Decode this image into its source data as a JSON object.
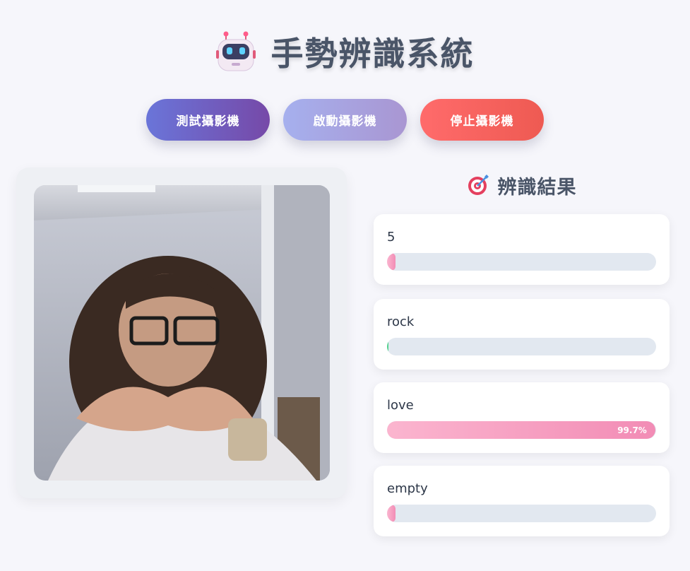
{
  "header": {
    "title": "手勢辨識系統",
    "icon": "robot-icon"
  },
  "buttons": {
    "test_camera": "測試攝影機",
    "start_camera": "啟動攝影機",
    "stop_camera": "停止攝影機"
  },
  "camera": {
    "description": "webcam-feed"
  },
  "results": {
    "title": "辨識結果",
    "icon": "target-icon",
    "items": [
      {
        "label": "5",
        "progress": 0.0,
        "percent_text": ""
      },
      {
        "label": "rock",
        "progress": 0.003,
        "percent_text": ""
      },
      {
        "label": "love",
        "progress": 0.997,
        "percent_text": "99.7%"
      },
      {
        "label": "empty",
        "progress": 0.0,
        "percent_text": ""
      }
    ]
  },
  "colors": {
    "accent_pink": "#f28cb5",
    "rock_green": "#4fd18b",
    "stop_red": "#ff6b6b",
    "test_purple": "#7649a8"
  }
}
